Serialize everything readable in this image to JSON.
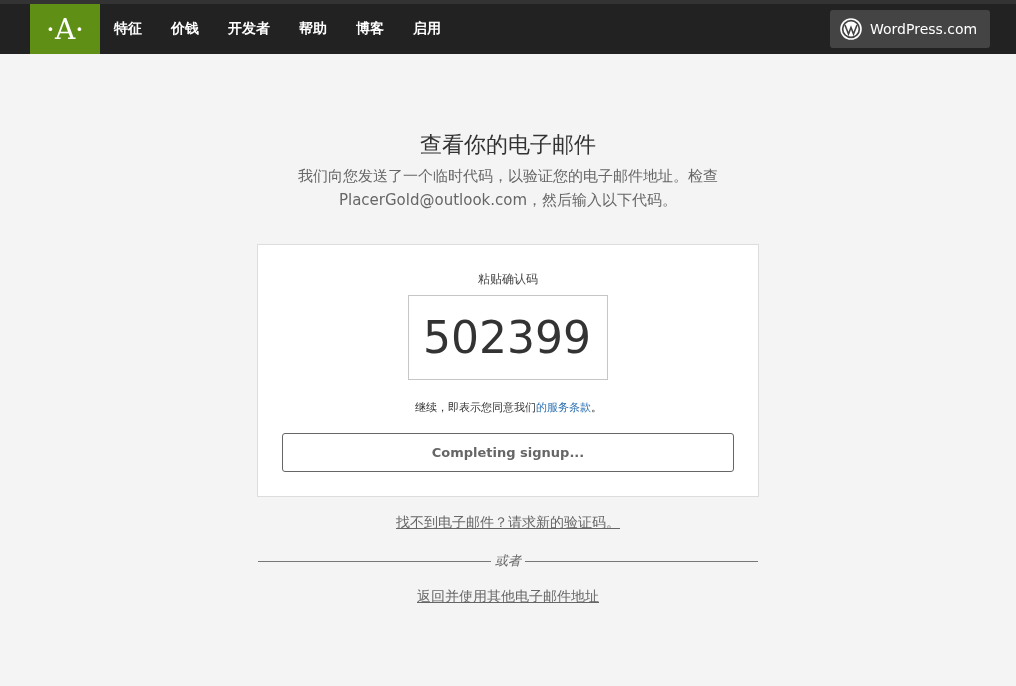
{
  "nav": {
    "logo": "·A·",
    "items": [
      "特征",
      "价钱",
      "开发者",
      "帮助",
      "博客",
      "启用"
    ],
    "wordpress_button": "WordPress.com"
  },
  "heading": "查看你的电子邮件",
  "intro": "我们向您发送了一个临时代码，以验证您的电子邮件地址。检查 PlacerGold@outlook.com，然后输入以下代码。",
  "card": {
    "code_label": "粘贴确认码",
    "code_value": "502399",
    "terms_prefix": "继续，即表示您同意我们",
    "terms_link": "的服务条款",
    "terms_suffix": "。",
    "submit_button": "Completing signup..."
  },
  "resend_link": "找不到电子邮件？请求新的验证码。",
  "divider_text": "或者",
  "back_link": "返回并使用其他电子邮件地址"
}
